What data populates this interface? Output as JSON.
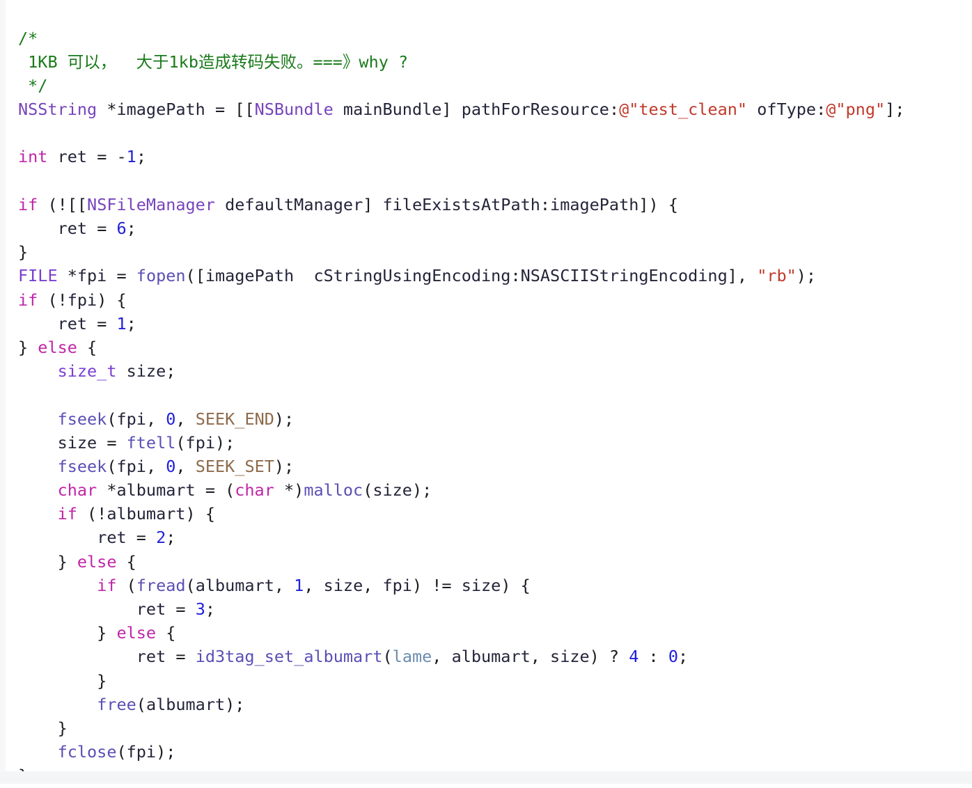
{
  "document": {
    "kind": "source-code-snippet",
    "language": "Objective-C",
    "background_color": "#ffffff",
    "gutter_color": "#f7f7f8",
    "bottom_band_color": "#f4f5f6"
  },
  "theme": {
    "comment": "#1a7a1a",
    "keyword": "#c026a8",
    "type": "#7a3fd0",
    "class_name": "#7744bb",
    "function": "#5a4fb5",
    "number": "#2020d8",
    "string": "#c0392b",
    "macro": "#8d6a4a",
    "global_variable": "#6b8cae",
    "plain_text": "#1b1b22"
  },
  "code": {
    "lines": [
      "/*",
      " 1KB 可以，  大于1kb造成转码失败。===》why ?",
      " */",
      "NSString *imagePath = [[NSBundle mainBundle] pathForResource:@\"test_clean\" ofType:@\"png\"];",
      "",
      "int ret = -1;",
      "",
      "if (![[NSFileManager defaultManager] fileExistsAtPath:imagePath]) {",
      "    ret = 6;",
      "}",
      "FILE *fpi = fopen([imagePath  cStringUsingEncoding:NSASCIIStringEncoding], \"rb\");",
      "if (!fpi) {",
      "    ret = 1;",
      "} else {",
      "    size_t size;",
      "",
      "    fseek(fpi, 0, SEEK_END);",
      "    size = ftell(fpi);",
      "    fseek(fpi, 0, SEEK_SET);",
      "    char *albumart = (char *)malloc(size);",
      "    if (!albumart) {",
      "        ret = 2;",
      "    } else {",
      "        if (fread(albumart, 1, size, fpi) != size) {",
      "            ret = 3;",
      "        } else {",
      "            ret = id3tag_set_albumart(lame, albumart, size) ? 4 : 0;",
      "        }",
      "        free(albumart);",
      "    }",
      "    fclose(fpi);",
      "}"
    ],
    "tokens": {
      "comment_open": "/*",
      "comment_body": " 1KB 可以，  大于1kb造成转码失败。===》why ?",
      "comment_close": " */",
      "string_literal_1": "@\"test_clean\"",
      "string_literal_2": "@\"png\"",
      "string_literal_3": "\"rb\"",
      "classes": [
        "NSString",
        "NSBundle",
        "NSFileManager",
        "FILE"
      ],
      "keywords": [
        "int",
        "if",
        "else",
        "char"
      ],
      "types": [
        "size_t"
      ],
      "functions": [
        "fopen",
        "fseek",
        "ftell",
        "malloc",
        "fread",
        "id3tag_set_albumart",
        "free",
        "fclose"
      ],
      "macros": [
        "SEEK_END",
        "SEEK_SET"
      ],
      "globals": [
        "lame"
      ],
      "numbers": [
        "1",
        "6",
        "0",
        "2",
        "3",
        "4"
      ],
      "selectors": [
        "mainBundle",
        "pathForResource",
        "ofType",
        "defaultManager",
        "fileExistsAtPath",
        "cStringUsingEncoding"
      ],
      "constants": [
        "NSASCIIStringEncoding"
      ],
      "identifiers": [
        "imagePath",
        "ret",
        "fpi",
        "size",
        "albumart"
      ]
    }
  }
}
